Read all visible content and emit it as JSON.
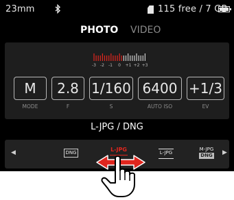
{
  "status": {
    "focal_length": "23mm",
    "storage": "115 free / 7 GB",
    "icons": [
      "bluetooth-icon",
      "sd-card-icon",
      "battery-icon"
    ]
  },
  "tabs": [
    {
      "label": "PHOTO",
      "active": true
    },
    {
      "label": "VIDEO",
      "active": false
    }
  ],
  "meter": {
    "scale": [
      "-3",
      "-2",
      "-1",
      "0",
      "+1",
      "+2",
      "+3"
    ],
    "accent_color": "#e0261e"
  },
  "settings": [
    {
      "value": "M",
      "label": "MODE"
    },
    {
      "value": "2.8",
      "label": "F"
    },
    {
      "value": "1/160",
      "label": "S"
    },
    {
      "value": "6400",
      "label": "AUTO ISO"
    },
    {
      "value": "+1/3",
      "label": "EV"
    }
  ],
  "format": {
    "current": "L-JPG / DNG",
    "options": [
      {
        "name": "DNG",
        "text": "DNG"
      },
      {
        "name": "L-JPG + DNG",
        "text": "L-JPG",
        "selected": true
      },
      {
        "name": "L-JPG",
        "text": "L-JPG"
      },
      {
        "name": "M-JPG + DNG",
        "text": "M-JPG",
        "text2": "DNG"
      }
    ]
  },
  "gesture": "swipe-horizontal-icon"
}
